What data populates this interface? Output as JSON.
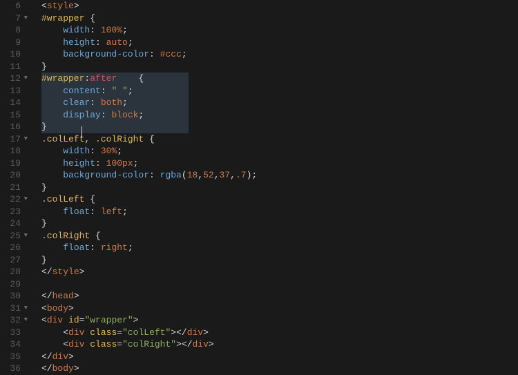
{
  "editor": {
    "first_line": 6,
    "last_line": 36,
    "fold_lines": [
      7,
      12,
      17,
      22,
      25,
      31,
      32
    ],
    "lines": {
      "6": [
        [
          "t-punct",
          "<"
        ],
        [
          "t-tag",
          "style"
        ],
        [
          "t-punct",
          ">"
        ]
      ],
      "7": [
        [
          "t-sel",
          "#wrapper "
        ],
        [
          "t-brace",
          "{"
        ]
      ],
      "8": [
        [
          "t-default",
          "    "
        ],
        [
          "t-prop",
          "width"
        ],
        [
          "t-punct",
          ": "
        ],
        [
          "t-val",
          "100%"
        ],
        [
          "t-punct",
          ";"
        ]
      ],
      "9": [
        [
          "t-default",
          "    "
        ],
        [
          "t-prop",
          "height"
        ],
        [
          "t-punct",
          ": "
        ],
        [
          "t-val",
          "auto"
        ],
        [
          "t-punct",
          ";"
        ]
      ],
      "10": [
        [
          "t-default",
          "    "
        ],
        [
          "t-prop",
          "background-color"
        ],
        [
          "t-punct",
          ": "
        ],
        [
          "t-val",
          "#ccc"
        ],
        [
          "t-punct",
          ";"
        ]
      ],
      "11": [
        [
          "t-brace",
          "}"
        ]
      ],
      "12": [
        [
          "t-sel",
          "#wrapper"
        ],
        [
          "t-punct",
          ":"
        ],
        [
          "t-pseudo",
          "after"
        ],
        [
          "t-default",
          "    "
        ],
        [
          "t-brace",
          "{"
        ]
      ],
      "13": [
        [
          "t-default",
          "    "
        ],
        [
          "t-prop",
          "content"
        ],
        [
          "t-punct",
          ": "
        ],
        [
          "t-str",
          "\" \""
        ],
        [
          "t-punct",
          ";"
        ]
      ],
      "14": [
        [
          "t-default",
          "    "
        ],
        [
          "t-prop",
          "clear"
        ],
        [
          "t-punct",
          ": "
        ],
        [
          "t-val",
          "both"
        ],
        [
          "t-punct",
          ";"
        ]
      ],
      "15": [
        [
          "t-default",
          "    "
        ],
        [
          "t-prop",
          "display"
        ],
        [
          "t-punct",
          ": "
        ],
        [
          "t-val",
          "block"
        ],
        [
          "t-punct",
          ";"
        ]
      ],
      "16": [
        [
          "t-brace",
          "}"
        ]
      ],
      "17": [
        [
          "t-sel",
          ".colLeft"
        ],
        [
          "t-punct",
          ", "
        ],
        [
          "t-sel",
          ".colRight "
        ],
        [
          "t-brace",
          "{"
        ]
      ],
      "18": [
        [
          "t-default",
          "    "
        ],
        [
          "t-prop",
          "width"
        ],
        [
          "t-punct",
          ": "
        ],
        [
          "t-val",
          "30%"
        ],
        [
          "t-punct",
          ";"
        ]
      ],
      "19": [
        [
          "t-default",
          "    "
        ],
        [
          "t-prop",
          "height"
        ],
        [
          "t-punct",
          ": "
        ],
        [
          "t-val",
          "100px"
        ],
        [
          "t-punct",
          ";"
        ]
      ],
      "20": [
        [
          "t-default",
          "    "
        ],
        [
          "t-prop",
          "background-color"
        ],
        [
          "t-punct",
          ": "
        ],
        [
          "t-func",
          "rgba"
        ],
        [
          "t-punct",
          "("
        ],
        [
          "t-num",
          "18"
        ],
        [
          "t-punct",
          ","
        ],
        [
          "t-num",
          "52"
        ],
        [
          "t-punct",
          ","
        ],
        [
          "t-num",
          "37"
        ],
        [
          "t-punct",
          ","
        ],
        [
          "t-num",
          ".7"
        ],
        [
          "t-punct",
          ");"
        ]
      ],
      "21": [
        [
          "t-brace",
          "}"
        ]
      ],
      "22": [
        [
          "t-sel",
          ".colLeft "
        ],
        [
          "t-brace",
          "{"
        ]
      ],
      "23": [
        [
          "t-default",
          "    "
        ],
        [
          "t-prop",
          "float"
        ],
        [
          "t-punct",
          ": "
        ],
        [
          "t-val",
          "left"
        ],
        [
          "t-punct",
          ";"
        ]
      ],
      "24": [
        [
          "t-brace",
          "}"
        ]
      ],
      "25": [
        [
          "t-sel",
          ".colRight "
        ],
        [
          "t-brace",
          "{"
        ]
      ],
      "26": [
        [
          "t-default",
          "    "
        ],
        [
          "t-prop",
          "float"
        ],
        [
          "t-punct",
          ": "
        ],
        [
          "t-val",
          "right"
        ],
        [
          "t-punct",
          ";"
        ]
      ],
      "27": [
        [
          "t-brace",
          "}"
        ]
      ],
      "28": [
        [
          "t-punct",
          "</"
        ],
        [
          "t-tag",
          "style"
        ],
        [
          "t-punct",
          ">"
        ]
      ],
      "29": [],
      "30": [
        [
          "t-punct",
          "</"
        ],
        [
          "t-tag",
          "head"
        ],
        [
          "t-punct",
          ">"
        ]
      ],
      "31": [
        [
          "t-punct",
          "<"
        ],
        [
          "t-tag",
          "body"
        ],
        [
          "t-punct",
          ">"
        ]
      ],
      "32": [
        [
          "t-punct",
          "<"
        ],
        [
          "t-tag",
          "div "
        ],
        [
          "t-attr",
          "id"
        ],
        [
          "t-punct",
          "="
        ],
        [
          "t-str",
          "\"wrapper\""
        ],
        [
          "t-punct",
          ">"
        ]
      ],
      "33": [
        [
          "t-default",
          "    "
        ],
        [
          "t-punct",
          "<"
        ],
        [
          "t-tag",
          "div "
        ],
        [
          "t-attr",
          "class"
        ],
        [
          "t-punct",
          "="
        ],
        [
          "t-str",
          "\"colLeft\""
        ],
        [
          "t-punct",
          "></"
        ],
        [
          "t-tag",
          "div"
        ],
        [
          "t-punct",
          ">"
        ]
      ],
      "34": [
        [
          "t-default",
          "    "
        ],
        [
          "t-punct",
          "<"
        ],
        [
          "t-tag",
          "div "
        ],
        [
          "t-attr",
          "class"
        ],
        [
          "t-punct",
          "="
        ],
        [
          "t-str",
          "\"colRight\""
        ],
        [
          "t-punct",
          "></"
        ],
        [
          "t-tag",
          "div"
        ],
        [
          "t-punct",
          ">"
        ]
      ],
      "35": [
        [
          "t-punct",
          "</"
        ],
        [
          "t-tag",
          "div"
        ],
        [
          "t-punct",
          ">"
        ]
      ],
      "36": [
        [
          "t-punct",
          "</"
        ],
        [
          "t-tag",
          "body"
        ],
        [
          "t-punct",
          ">"
        ]
      ]
    }
  }
}
